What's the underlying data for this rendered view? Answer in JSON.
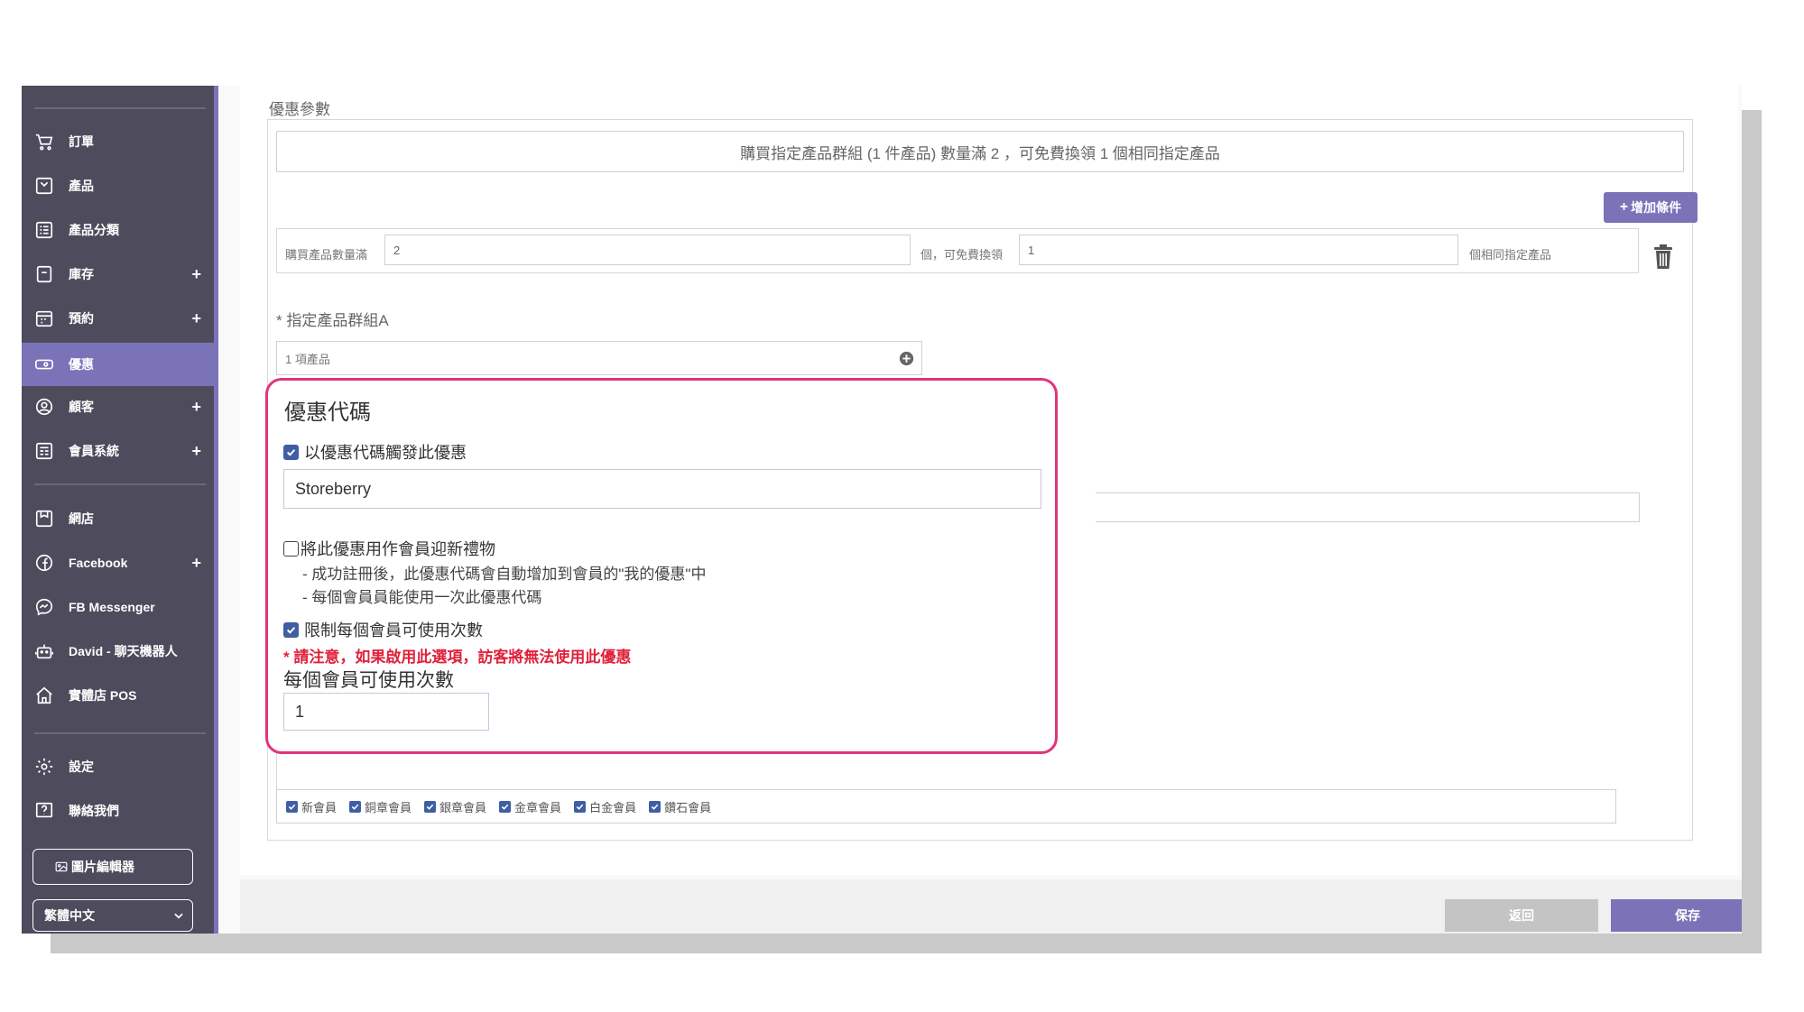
{
  "sidebar": {
    "items": [
      {
        "label": "訂單",
        "icon": "cart-icon",
        "plus": ""
      },
      {
        "label": "產品",
        "icon": "product-icon",
        "plus": ""
      },
      {
        "label": "產品分類",
        "icon": "category-icon",
        "plus": ""
      },
      {
        "label": "庫存",
        "icon": "inventory-icon",
        "plus": "+"
      },
      {
        "label": "預約",
        "icon": "calendar-icon",
        "plus": "+"
      },
      {
        "label": "優惠",
        "icon": "ticket-icon",
        "plus": ""
      },
      {
        "label": "顧客",
        "icon": "customer-icon",
        "plus": "+"
      },
      {
        "label": "會員系統",
        "icon": "membership-icon",
        "plus": "+"
      },
      {
        "label": "網店",
        "icon": "store-icon",
        "plus": ""
      },
      {
        "label": "Facebook",
        "icon": "facebook-icon",
        "plus": "+"
      },
      {
        "label": "FB Messenger",
        "icon": "messenger-icon",
        "plus": ""
      },
      {
        "label": "David - 聊天機器人",
        "icon": "chatbot-icon",
        "plus": ""
      },
      {
        "label": "實體店 POS",
        "icon": "pos-icon",
        "plus": ""
      },
      {
        "label": "設定",
        "icon": "gear-icon",
        "plus": ""
      },
      {
        "label": "聯絡我們",
        "icon": "help-icon",
        "plus": ""
      }
    ],
    "image_editor_label": "圖片編輯器",
    "language_value": "繁體中文"
  },
  "params": {
    "section_title": "優惠參數",
    "summary": "購買指定產品群組 (1 件產品) 數量滿 2 ，可免費換領 1 個相同指定產品",
    "add_condition_label": "增加條件",
    "buy_qty_label": "購買產品數量滿",
    "buy_qty_value": "2",
    "free_label": "個，可免費換領",
    "free_value": "1",
    "same_product_label": "個相同指定產品",
    "group_label": "* 指定產品群組A",
    "group_value": "1 項產品"
  },
  "promo": {
    "heading": "優惠代碼",
    "trigger_label": "以優惠代碼觸發此優惠",
    "code_value": "Storeberry",
    "welcome_gift_label": "將此優惠用作會員迎新禮物",
    "welcome_note_1": "- 成功註冊後，此優惠代碼會自動增加到會員的\"我的優惠\"中",
    "welcome_note_2": "- 每個會員員能使用一次此優惠代碼",
    "limit_label": "限制每個會員可使用次數",
    "warning": "* 請注意，如果啟用此選項，訪客將無法使用此優惠",
    "uses_label": "每個會員可使用次數",
    "uses_value": "1"
  },
  "tiers": [
    "新會員",
    "銅章會員",
    "銀章會員",
    "金章會員",
    "白金會員",
    "鑽石會員"
  ],
  "footer": {
    "back_label": "返回",
    "save_label": "保存"
  },
  "colors": {
    "sidebar_bg": "#4d4b5c",
    "accent": "#7b73b8",
    "highlight_border": "#e0357d",
    "warning": "#e0213b",
    "checkbox": "#3f5ea3"
  }
}
